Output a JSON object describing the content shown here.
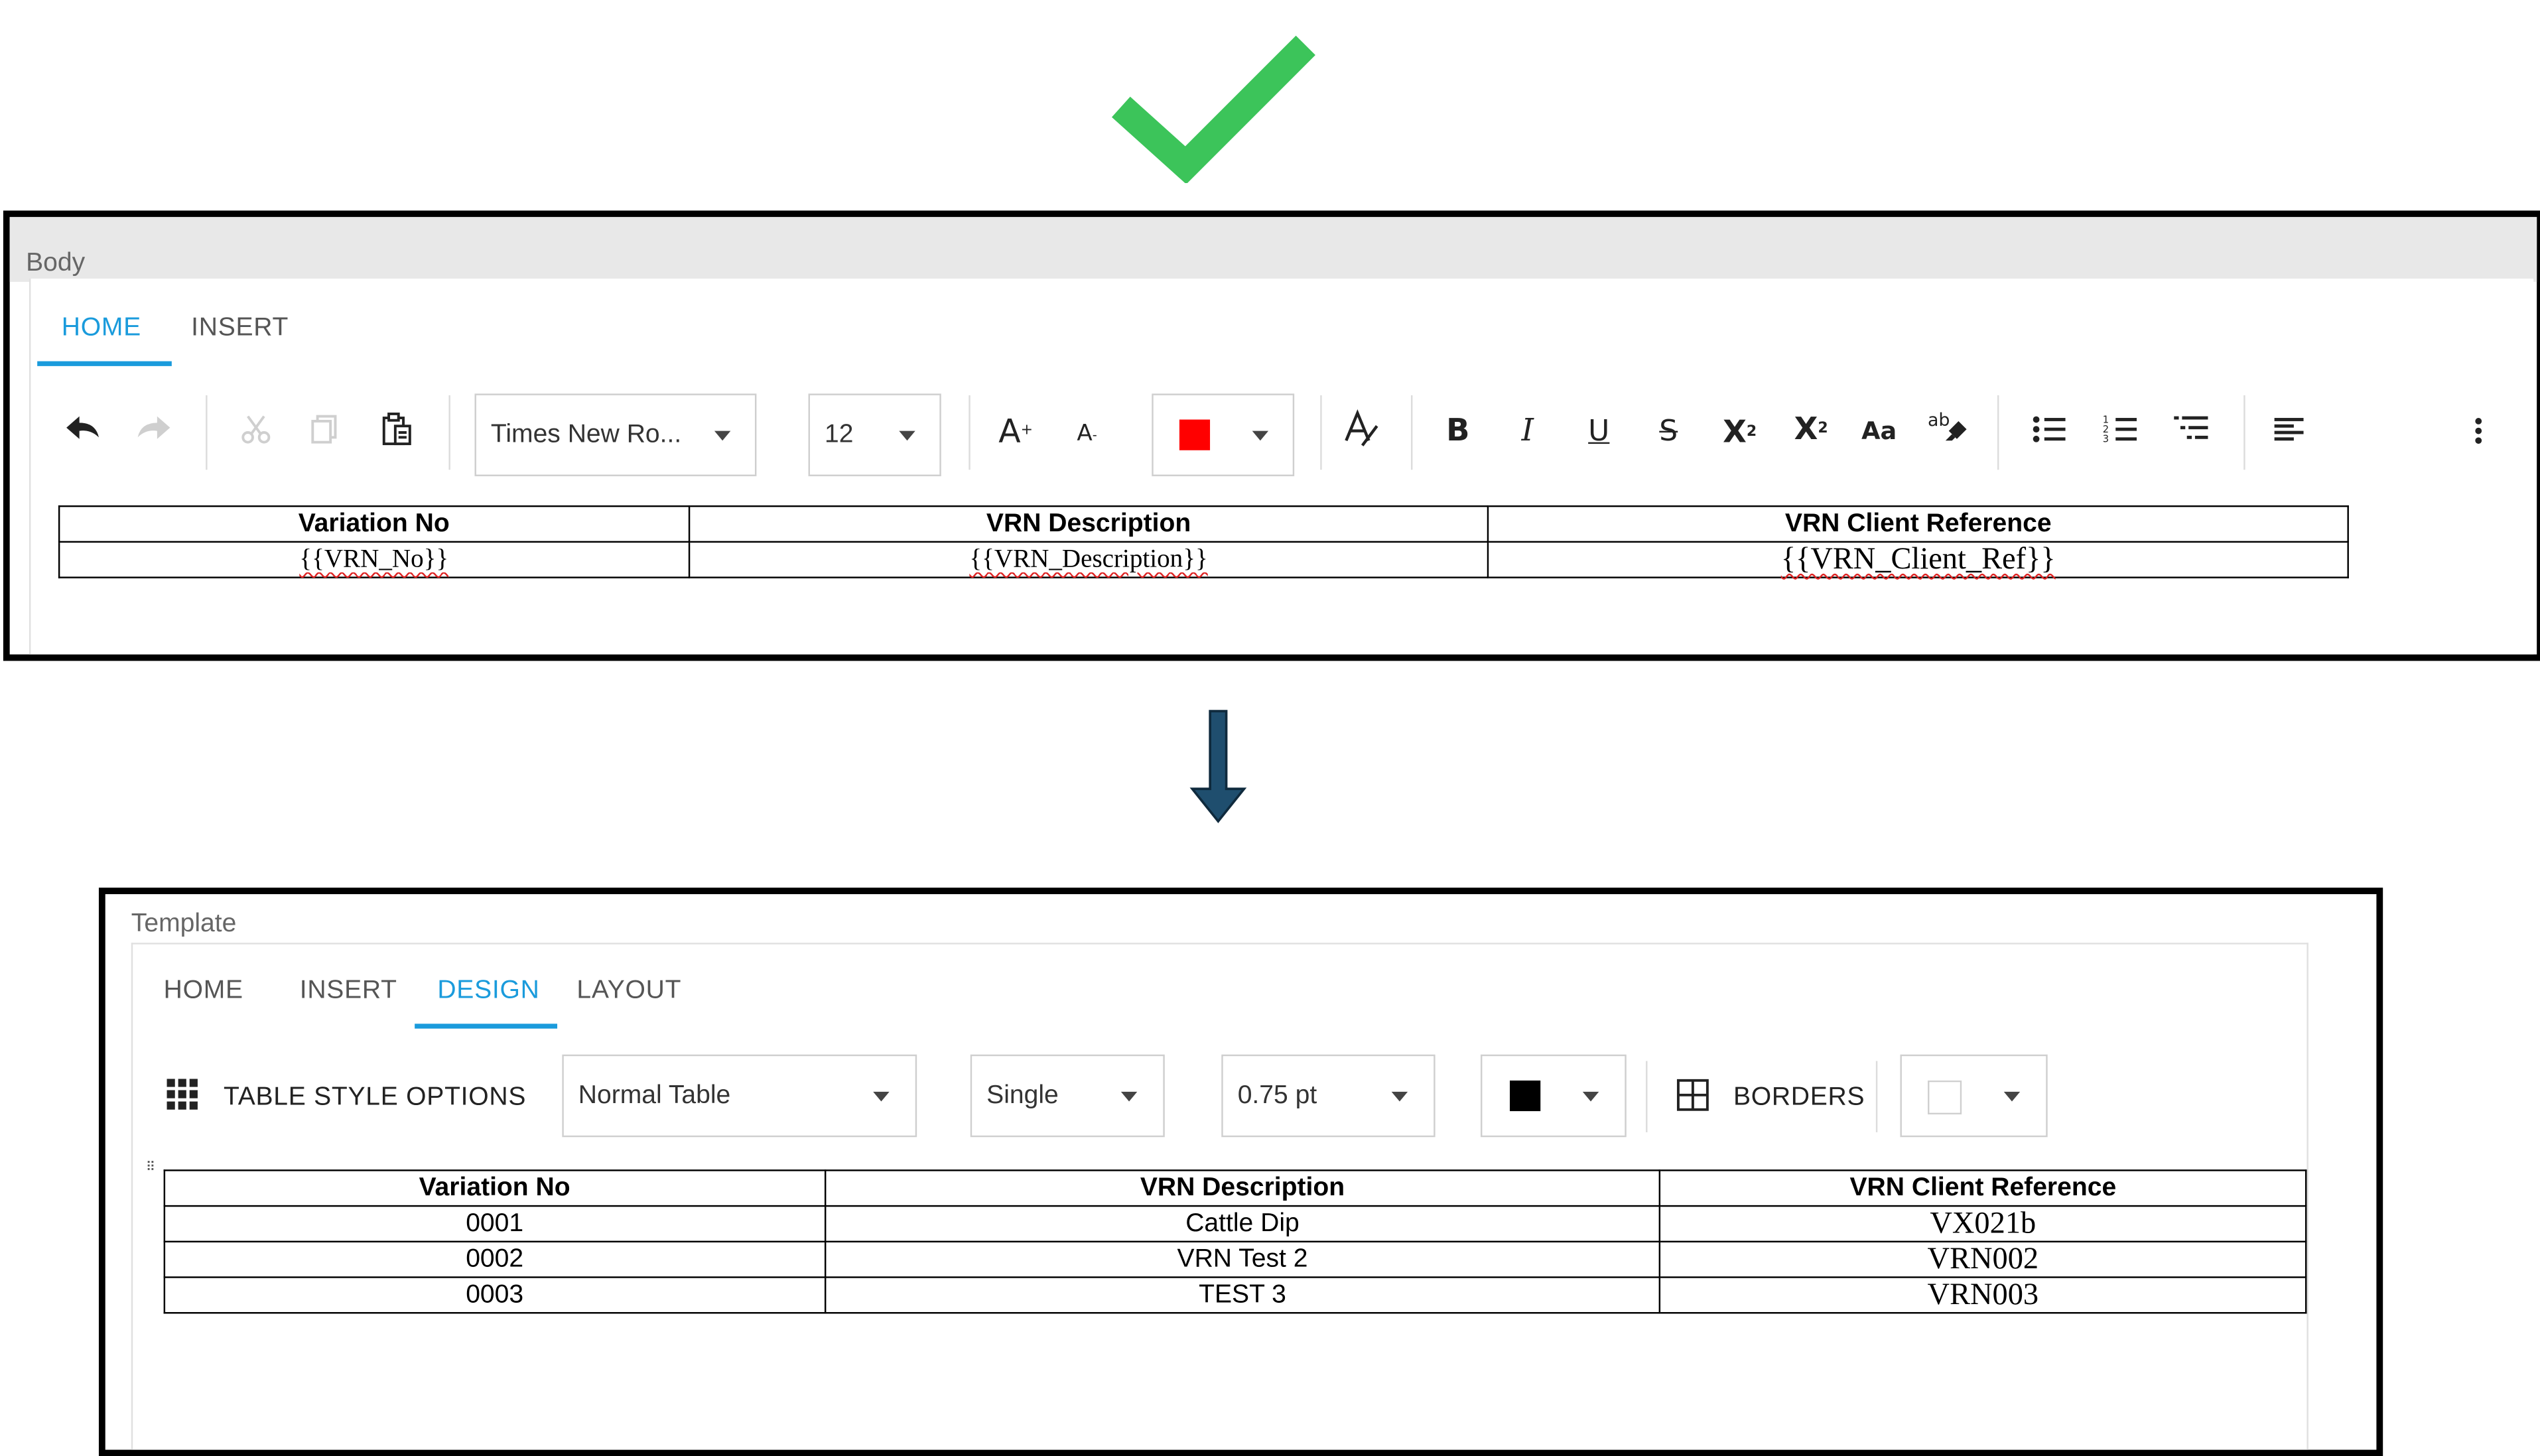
{
  "top_panel": {
    "label": "Body",
    "tabs": [
      {
        "label": "HOME",
        "active": true
      },
      {
        "label": "INSERT",
        "active": false
      }
    ],
    "toolbar": {
      "icons": [
        "undo-icon",
        "redo-icon",
        "cut-icon",
        "copy-icon",
        "paste-icon",
        "grow-font-icon",
        "shrink-font-icon",
        "clear-formatting-icon",
        "bold-icon",
        "italic-icon",
        "underline-icon",
        "strikethrough-icon",
        "subscript-icon",
        "superscript-icon",
        "change-case-icon",
        "highlight-icon",
        "bullet-list-icon",
        "numbered-list-icon",
        "multilevel-list-icon",
        "align-left-icon",
        "more-options-icon"
      ],
      "font_family": "Times New Ro...",
      "font_size": "12",
      "font_color": "#ff0000"
    },
    "table": {
      "headers": [
        "Variation No",
        "VRN Description",
        "VRN Client Reference"
      ],
      "rows": [
        [
          "{{VRN_No}}",
          "{{VRN_Description}}",
          "{{VRN_Client_Ref}}"
        ]
      ]
    }
  },
  "bottom_panel": {
    "label": "Template",
    "tabs": [
      {
        "label": "HOME",
        "active": false
      },
      {
        "label": "INSERT",
        "active": false
      },
      {
        "label": "DESIGN",
        "active": true
      },
      {
        "label": "LAYOUT",
        "active": false
      }
    ],
    "toolbar": {
      "table_style_options_label": "TABLE STYLE OPTIONS",
      "table_style": "Normal Table",
      "border_style": "Single",
      "border_width": "0.75 pt",
      "border_color": "#000000",
      "borders_label": "BORDERS",
      "shading_color": "#ffffff"
    },
    "table": {
      "headers": [
        "Variation No",
        "VRN Description",
        "VRN Client Reference"
      ],
      "rows": [
        [
          "0001",
          "Cattle Dip",
          "VX021b"
        ],
        [
          "0002",
          "VRN Test 2",
          "VRN002"
        ],
        [
          "0003",
          "TEST 3",
          "VRN003"
        ]
      ]
    }
  },
  "colors": {
    "accent": "#1a9bdc",
    "checkmark": "#3cc45a",
    "arrow": "#1f4e6e"
  }
}
